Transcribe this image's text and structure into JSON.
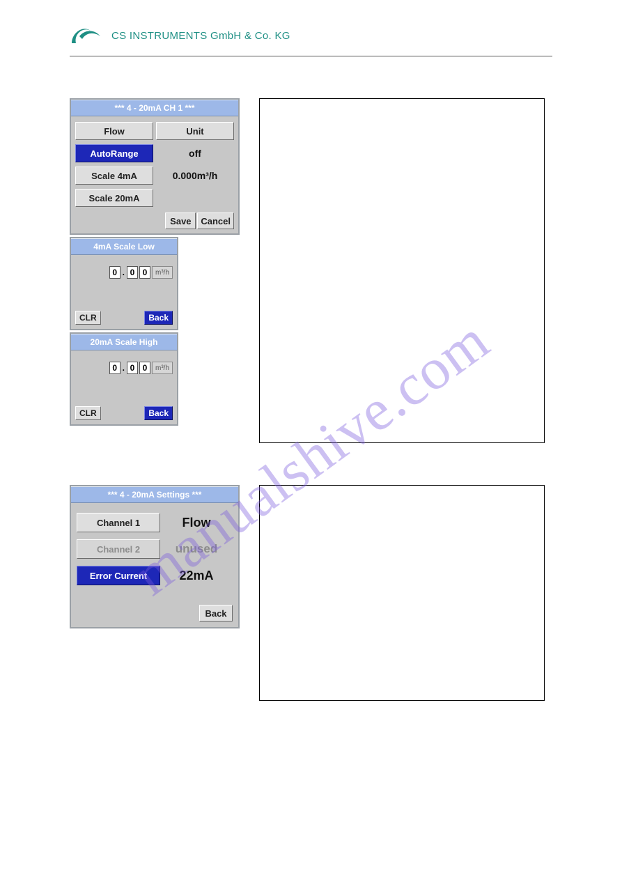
{
  "company": "CS INSTRUMENTS GmbH & Co. KG",
  "panel1": {
    "title": "***   4 - 20mA CH 1 ***",
    "flow_btn": "Flow",
    "unit_btn": "Unit",
    "autorange_btn": "AutoRange",
    "autorange_val": "off",
    "scale4_btn": "Scale  4mA",
    "scale4_val": "0.000m³/h",
    "scale20_btn": "Scale  20mA",
    "save": "Save",
    "cancel": "Cancel"
  },
  "scaleLow": {
    "title": "4mA Scale Low",
    "d0": "0",
    "d1": "0",
    "d2": "0",
    "sep": ".",
    "unit": "m³/h",
    "clr": "CLR",
    "back": "Back"
  },
  "scaleHigh": {
    "title": "20mA Scale High",
    "d0": "0",
    "d1": "0",
    "d2": "0",
    "sep": ".",
    "unit": "m³/h",
    "clr": "CLR",
    "back": "Back"
  },
  "panel2": {
    "title": "***   4 - 20mA Settings ***",
    "ch1_btn": "Channel 1",
    "ch1_val": "Flow",
    "ch2_btn": "Channel 2",
    "ch2_val": "unused",
    "err_btn": "Error Current",
    "err_val": "22mA",
    "back": "Back"
  },
  "watermark": "manualshive.com"
}
